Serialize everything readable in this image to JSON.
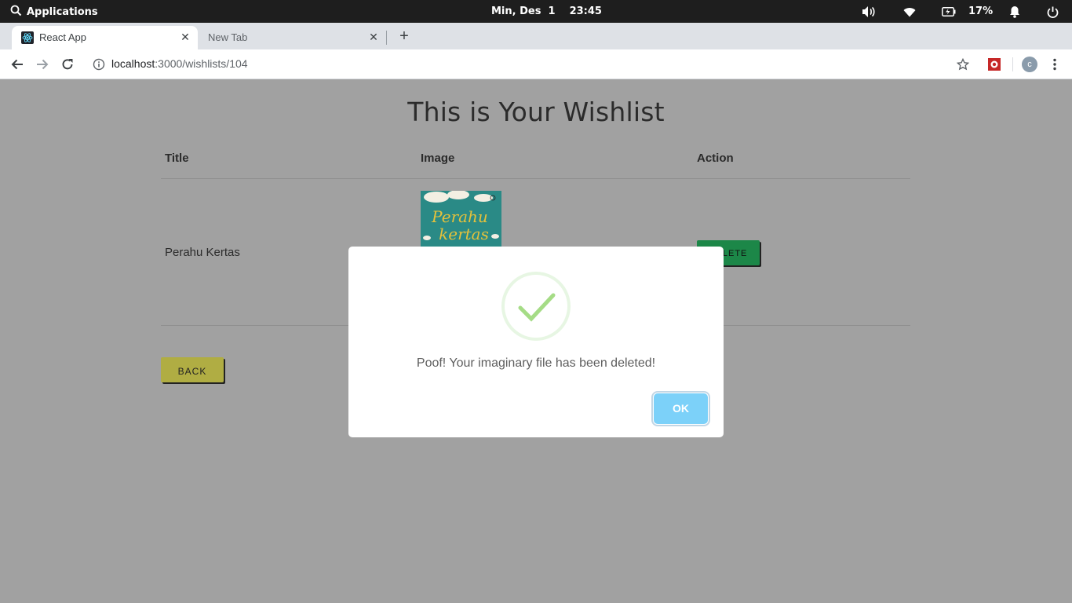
{
  "system_bar": {
    "applications_label": "Applications",
    "date": "Min, Des  1",
    "time": "23:45",
    "battery_percent": "17%"
  },
  "browser": {
    "tabs": [
      {
        "title": "React App",
        "active": true
      },
      {
        "title": "New Tab",
        "active": false
      }
    ],
    "url_host": "localhost",
    "url_path": ":3000/wishlists/104",
    "profile_initial": "c"
  },
  "page": {
    "heading": "This is Your Wishlist",
    "columns": [
      "Title",
      "Image",
      "Action"
    ],
    "rows": [
      {
        "title": "Perahu Kertas",
        "image_alt": "Perahu kertas",
        "action": "DELETE"
      }
    ],
    "back_label": "BACK"
  },
  "modal": {
    "message": "Poof! Your imaginary file has been deleted!",
    "ok_label": "OK"
  },
  "colors": {
    "overlay_bg": "#a1a1a1",
    "delete_btn": "#1c8748",
    "back_btn": "#b0ad43",
    "ok_btn": "#7cd1f9",
    "success_check": "#a5dc86"
  }
}
